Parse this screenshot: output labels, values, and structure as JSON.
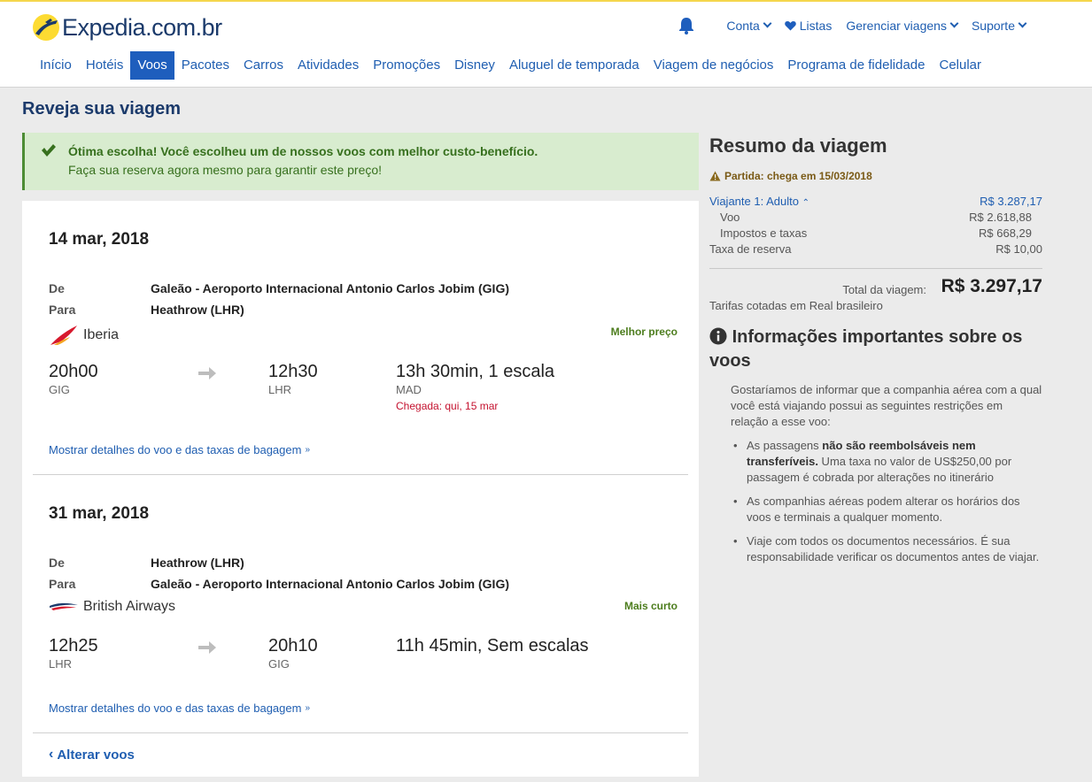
{
  "header": {
    "logo_text": "Expedia.com.br",
    "links": {
      "account": "Conta",
      "lists": "Listas",
      "manage": "Gerenciar viagens",
      "support": "Suporte"
    },
    "nav": [
      "Início",
      "Hotéis",
      "Voos",
      "Pacotes",
      "Carros",
      "Atividades",
      "Promoções",
      "Disney",
      "Aluguel de temporada",
      "Viagem de negócios",
      "Programa de fidelidade",
      "Celular"
    ],
    "nav_active": "Voos"
  },
  "page": {
    "title": "Reveja sua viagem"
  },
  "alert": {
    "line1": "Ótima escolha! Você escolheu um de nossos voos com melhor custo-benefício.",
    "line2": "Faça sua reserva agora mesmo para garantir este preço!"
  },
  "flights": [
    {
      "date": "14 mar, 2018",
      "from_label": "De",
      "from": "Galeão - Aeroporto Internacional Antonio Carlos Jobim (GIG)",
      "to_label": "Para",
      "to": "Heathrow (LHR)",
      "airline": "Iberia",
      "badge": "Melhor preço",
      "depart_time": "20h00",
      "depart_code": "GIG",
      "arrive_time": "12h30",
      "arrive_code": "LHR",
      "duration": "13h 30min, 1 escala",
      "stop_code": "MAD",
      "arrival_note": "Chegada: qui, 15 mar",
      "details": "Mostrar detalhes do voo e das taxas de bagagem"
    },
    {
      "date": "31 mar, 2018",
      "from_label": "De",
      "from": "Heathrow (LHR)",
      "to_label": "Para",
      "to": "Galeão - Aeroporto Internacional Antonio Carlos Jobim (GIG)",
      "airline": "British Airways",
      "badge": "Mais curto",
      "depart_time": "12h25",
      "depart_code": "LHR",
      "arrive_time": "20h10",
      "arrive_code": "GIG",
      "duration": "11h 45min, Sem escalas",
      "details": "Mostrar detalhes do voo e das taxas de bagagem"
    }
  ],
  "change_flights": "Alterar voos",
  "summary": {
    "title": "Resumo da viagem",
    "warning": "Partida: chega em 15/03/2018",
    "traveler_label": "Viajante 1: Adulto",
    "traveler_value": "R$ 3.287,17",
    "flight_label": "Voo",
    "flight_value": "R$ 2.618,88",
    "taxes_label": "Impostos e taxas",
    "taxes_value": "R$ 668,29",
    "booking_label": "Taxa de reserva",
    "booking_value": "R$ 10,00",
    "total_label": "Total da viagem:",
    "total_value": "R$ 3.297,17",
    "currency_note": "Tarifas cotadas em Real brasileiro",
    "info_title": "Informações importantes sobre os voos",
    "info_text": "Gostaríamos de informar que a companhia aérea com a qual você está viajando possui as seguintes restrições em relação a esse voo:",
    "bullets": {
      "b1_pre": "As passagens ",
      "b1_bold": "não são reembolsáveis nem transferíveis.",
      "b1_post": " Uma taxa no valor de US$250,00 por passagem é cobrada por alterações no itinerário",
      "b2": "As companhias aéreas podem alterar os horários dos voos e terminais a qualquer momento.",
      "b3": "Viaje com todos os documentos necessários. É sua responsabilidade verificar os documentos antes de viajar."
    }
  }
}
